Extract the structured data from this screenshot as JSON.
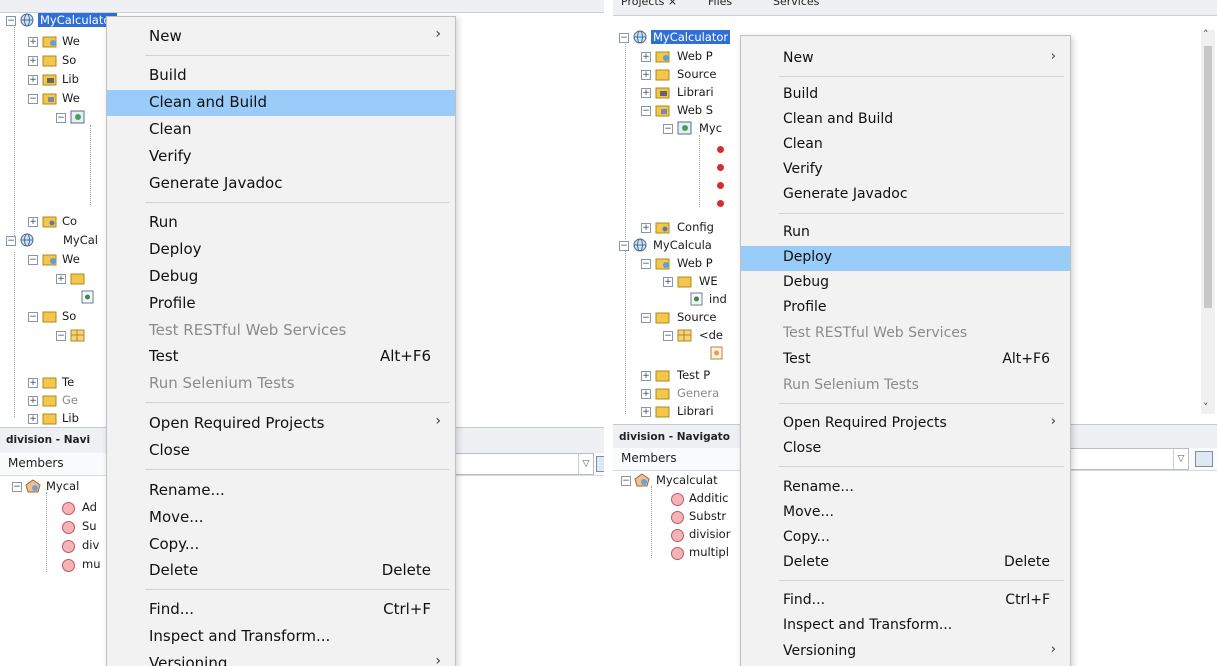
{
  "left": {
    "tree": {
      "project_root": "MyCalculator",
      "nodes": [
        "We",
        "So",
        "Lib",
        "We",
        "Co",
        "MyCal",
        "We",
        "So",
        "Te",
        "Ge",
        "Lib"
      ]
    },
    "navigator": {
      "title": "division - Navi",
      "members_label": "Members",
      "class_name": "Mycal",
      "methods": [
        "Ad",
        "Su",
        "div",
        "mu"
      ]
    },
    "menu": {
      "items": [
        "New",
        "Build",
        "Clean and Build",
        "Clean",
        "Verify",
        "Generate Javadoc",
        "Run",
        "Deploy",
        "Debug",
        "Profile",
        "Test RESTful Web Services",
        "Test",
        "Run Selenium Tests",
        "Open Required Projects",
        "Close",
        "Rename...",
        "Move...",
        "Copy...",
        "Delete",
        "Find...",
        "Inspect and Transform...",
        "Versioning"
      ],
      "shortcut_test": "Alt+F6",
      "shortcut_delete": "Delete",
      "shortcut_find": "Ctrl+F",
      "highlighted": "Clean and Build"
    }
  },
  "right": {
    "tabs": [
      "Projects ×",
      "Files",
      "Services"
    ],
    "tree": {
      "project_root": "MyCalculator",
      "nodes": [
        "Web P",
        "Source",
        "Librari",
        "Web S",
        "Myc",
        "Config",
        "MyCalcula",
        "Web P",
        "WE",
        "ind",
        "Source",
        "<de",
        "Test P",
        "Genera",
        "Librari"
      ]
    },
    "navigator": {
      "title": "division - Navigato",
      "members_label": "Members",
      "class_name": "Mycalculat",
      "methods": [
        "Additic",
        "Substr",
        "divisior",
        "multipl"
      ]
    },
    "menu": {
      "items": [
        "New",
        "Build",
        "Clean and Build",
        "Clean",
        "Verify",
        "Generate Javadoc",
        "Run",
        "Deploy",
        "Debug",
        "Profile",
        "Test RESTful Web Services",
        "Test",
        "Run Selenium Tests",
        "Open Required Projects",
        "Close",
        "Rename...",
        "Move...",
        "Copy...",
        "Delete",
        "Find...",
        "Inspect and Transform...",
        "Versioning"
      ],
      "shortcut_test": "Alt+F6",
      "shortcut_delete": "Delete",
      "shortcut_find": "Ctrl+F",
      "highlighted": "Deploy"
    }
  },
  "colors": {
    "selection": "#2f6fd6",
    "menu_highlight": "#99ccf8",
    "menu_bg": "#f2f2f2",
    "disabled_text": "#8b8b8b"
  },
  "icons": [
    "globe-icon",
    "folder-icon",
    "web-folder-icon",
    "library-icon",
    "package-icon",
    "method-icon",
    "class-icon",
    "submenu-arrow-icon"
  ]
}
